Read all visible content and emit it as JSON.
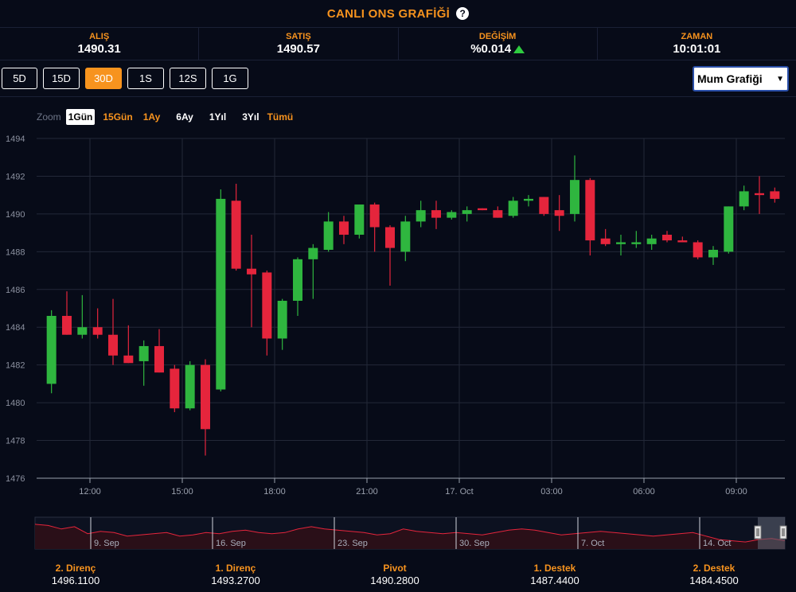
{
  "header": {
    "title": "CANLI ONS GRAFİĞİ",
    "help": "?"
  },
  "quotes": [
    {
      "label": "ALIŞ",
      "value": "1490.31"
    },
    {
      "label": "SATIŞ",
      "value": "1490.57"
    },
    {
      "label": "DEĞİŞİM",
      "value": "%0.014",
      "direction": "up"
    },
    {
      "label": "ZAMAN",
      "value": "10:01:01"
    }
  ],
  "ranges": {
    "items": [
      "5D",
      "15D",
      "30D",
      "1S",
      "12S",
      "1G"
    ],
    "active": "30D"
  },
  "chart_type_select": {
    "value": "Mum Grafiği"
  },
  "zoom": {
    "label": "Zoom",
    "items": [
      "1Gün",
      "15Gün",
      "1Ay",
      "6Ay",
      "1Yıl",
      "3Yıl",
      "Tümü"
    ],
    "selected": "1Gün",
    "highlighted": [
      "15Gün",
      "1Ay",
      "Tümü"
    ]
  },
  "colors": {
    "up": "#2fb63f",
    "down": "#e5253c",
    "accent": "#f7931e",
    "background": "#070b18",
    "grid": "#232838"
  },
  "chart_data": {
    "type": "candlestick",
    "ylim": [
      1476,
      1494
    ],
    "yticks": [
      1476,
      1478,
      1480,
      1482,
      1484,
      1486,
      1488,
      1490,
      1492,
      1494
    ],
    "xticks": [
      "12:00",
      "15:00",
      "18:00",
      "21:00",
      "17. Oct",
      "03:00",
      "06:00",
      "09:00"
    ],
    "interval_minutes": 30,
    "first_candle": "10:30",
    "candles": [
      {
        "o": 1481.0,
        "h": 1484.9,
        "l": 1480.5,
        "c": 1484.6
      },
      {
        "o": 1484.6,
        "h": 1485.9,
        "l": 1483.6,
        "c": 1483.6
      },
      {
        "o": 1483.6,
        "h": 1485.7,
        "l": 1483.4,
        "c": 1484.0
      },
      {
        "o": 1484.0,
        "h": 1485.0,
        "l": 1483.4,
        "c": 1483.6
      },
      {
        "o": 1483.6,
        "h": 1485.5,
        "l": 1482.0,
        "c": 1482.5
      },
      {
        "o": 1482.5,
        "h": 1484.1,
        "l": 1482.1,
        "c": 1482.1
      },
      {
        "o": 1482.2,
        "h": 1483.3,
        "l": 1480.9,
        "c": 1483.0
      },
      {
        "o": 1483.0,
        "h": 1483.9,
        "l": 1481.6,
        "c": 1481.6
      },
      {
        "o": 1481.8,
        "h": 1482.0,
        "l": 1479.5,
        "c": 1479.7
      },
      {
        "o": 1479.7,
        "h": 1482.2,
        "l": 1479.6,
        "c": 1482.0
      },
      {
        "o": 1482.0,
        "h": 1482.3,
        "l": 1477.2,
        "c": 1478.6
      },
      {
        "o": 1480.7,
        "h": 1491.3,
        "l": 1480.6,
        "c": 1490.8
      },
      {
        "o": 1490.7,
        "h": 1491.6,
        "l": 1487.0,
        "c": 1487.1
      },
      {
        "o": 1487.1,
        "h": 1488.9,
        "l": 1484.0,
        "c": 1486.8
      },
      {
        "o": 1486.9,
        "h": 1487.0,
        "l": 1482.5,
        "c": 1483.4
      },
      {
        "o": 1483.4,
        "h": 1485.5,
        "l": 1482.8,
        "c": 1485.4
      },
      {
        "o": 1485.4,
        "h": 1487.7,
        "l": 1484.6,
        "c": 1487.6
      },
      {
        "o": 1487.6,
        "h": 1488.4,
        "l": 1485.5,
        "c": 1488.2
      },
      {
        "o": 1488.1,
        "h": 1490.1,
        "l": 1488.0,
        "c": 1489.6
      },
      {
        "o": 1489.6,
        "h": 1489.9,
        "l": 1488.4,
        "c": 1488.9
      },
      {
        "o": 1488.9,
        "h": 1490.5,
        "l": 1488.7,
        "c": 1490.5
      },
      {
        "o": 1490.5,
        "h": 1490.6,
        "l": 1488.0,
        "c": 1489.3
      },
      {
        "o": 1489.3,
        "h": 1489.4,
        "l": 1486.2,
        "c": 1488.2
      },
      {
        "o": 1488.0,
        "h": 1489.9,
        "l": 1487.5,
        "c": 1489.6
      },
      {
        "o": 1489.6,
        "h": 1490.7,
        "l": 1489.3,
        "c": 1490.2
      },
      {
        "o": 1490.2,
        "h": 1490.7,
        "l": 1489.2,
        "c": 1489.8
      },
      {
        "o": 1489.8,
        "h": 1490.2,
        "l": 1489.7,
        "c": 1490.1
      },
      {
        "o": 1490.0,
        "h": 1490.4,
        "l": 1489.6,
        "c": 1490.2
      },
      {
        "o": 1490.3,
        "h": 1490.3,
        "l": 1490.2,
        "c": 1490.2
      },
      {
        "o": 1490.2,
        "h": 1490.4,
        "l": 1489.8,
        "c": 1489.8
      },
      {
        "o": 1489.9,
        "h": 1490.9,
        "l": 1489.8,
        "c": 1490.7
      },
      {
        "o": 1490.7,
        "h": 1491.0,
        "l": 1490.4,
        "c": 1490.8
      },
      {
        "o": 1490.9,
        "h": 1490.9,
        "l": 1489.9,
        "c": 1490.0
      },
      {
        "o": 1490.2,
        "h": 1491.0,
        "l": 1489.1,
        "c": 1489.9
      },
      {
        "o": 1490.0,
        "h": 1493.1,
        "l": 1489.6,
        "c": 1491.8
      },
      {
        "o": 1491.8,
        "h": 1491.9,
        "l": 1487.8,
        "c": 1488.6
      },
      {
        "o": 1488.7,
        "h": 1489.2,
        "l": 1488.3,
        "c": 1488.4
      },
      {
        "o": 1488.4,
        "h": 1488.9,
        "l": 1487.8,
        "c": 1488.5
      },
      {
        "o": 1488.4,
        "h": 1489.1,
        "l": 1488.2,
        "c": 1488.5
      },
      {
        "o": 1488.4,
        "h": 1488.9,
        "l": 1488.1,
        "c": 1488.7
      },
      {
        "o": 1488.9,
        "h": 1489.1,
        "l": 1488.5,
        "c": 1488.6
      },
      {
        "o": 1488.6,
        "h": 1488.8,
        "l": 1488.5,
        "c": 1488.5
      },
      {
        "o": 1488.5,
        "h": 1488.6,
        "l": 1487.6,
        "c": 1487.7
      },
      {
        "o": 1487.7,
        "h": 1488.3,
        "l": 1487.3,
        "c": 1488.1
      },
      {
        "o": 1488.0,
        "h": 1490.4,
        "l": 1487.9,
        "c": 1490.4
      },
      {
        "o": 1490.4,
        "h": 1491.5,
        "l": 1490.2,
        "c": 1491.2
      },
      {
        "o": 1491.1,
        "h": 1492.0,
        "l": 1490.0,
        "c": 1491.0
      },
      {
        "o": 1491.2,
        "h": 1491.4,
        "l": 1490.6,
        "c": 1490.8
      }
    ],
    "navigator": {
      "labels": [
        "9. Sep",
        "16. Sep",
        "23. Sep",
        "30. Sep",
        "7. Oct",
        "14. Oct"
      ],
      "series": [
        1507,
        1506,
        1503,
        1505,
        1499,
        1501,
        1500,
        1497,
        1498,
        1499,
        1500,
        1497,
        1498,
        1500,
        1499,
        1501,
        1502,
        1500,
        1499,
        1500,
        1503,
        1505,
        1503,
        1502,
        1501,
        1500,
        1498,
        1499,
        1503,
        1501,
        1500,
        1499,
        1500,
        1499,
        1498,
        1500,
        1502,
        1503,
        1502,
        1500,
        1498,
        1499,
        1500,
        1501,
        1500,
        1499,
        1498,
        1497,
        1498,
        1499,
        1500,
        1497,
        1494,
        1493,
        1492,
        1494,
        1495,
        1493
      ]
    }
  },
  "pivots": [
    {
      "label": "2. Direnç",
      "value": "1496.1100"
    },
    {
      "label": "1. Direnç",
      "value": "1493.2700"
    },
    {
      "label": "Pivot",
      "value": "1490.2800"
    },
    {
      "label": "1. Destek",
      "value": "1487.4400"
    },
    {
      "label": "2. Destek",
      "value": "1484.4500"
    }
  ]
}
